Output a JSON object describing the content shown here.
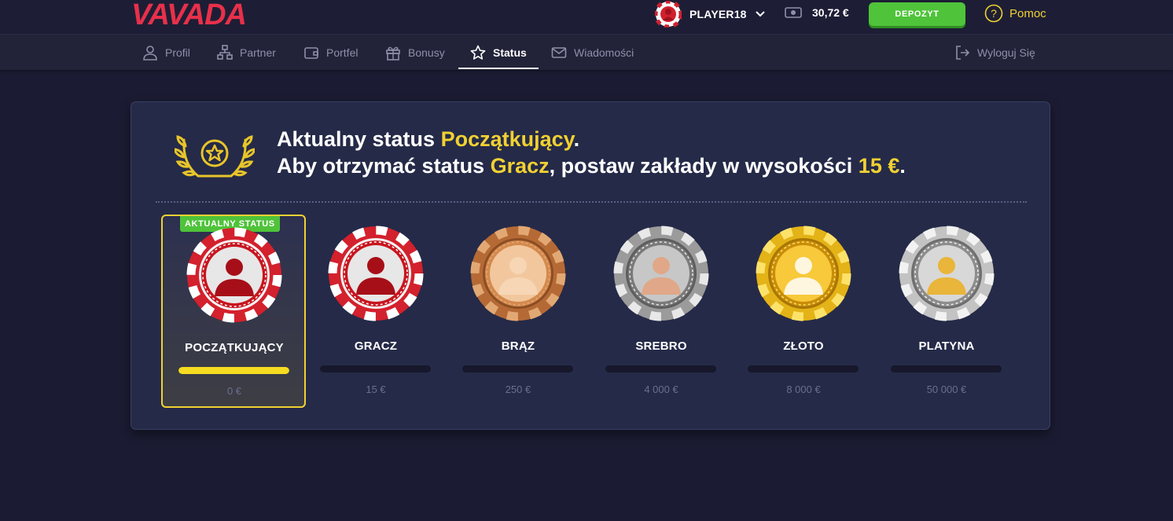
{
  "header": {
    "logo_text": "VAVADA",
    "username": "PLAYER18",
    "balance": "30,72 €",
    "deposit_label": "DEPOZYT",
    "help_label": "Pomoc"
  },
  "nav": {
    "items": [
      {
        "label": "Profil",
        "icon": "user-icon"
      },
      {
        "label": "Partner",
        "icon": "network-icon"
      },
      {
        "label": "Portfel",
        "icon": "wallet-icon"
      },
      {
        "label": "Bonusy",
        "icon": "gift-icon"
      },
      {
        "label": "Status",
        "icon": "star-icon",
        "active": true
      },
      {
        "label": "Wiadomości",
        "icon": "mail-icon"
      }
    ],
    "logout_label": "Wyloguj Się"
  },
  "status": {
    "line1_prefix": "Aktualny status ",
    "current_status": "Początkujący",
    "line1_suffix": ".",
    "line2_prefix": "Aby otrzymać status ",
    "next_status": "Gracz",
    "line2_middle": ", postaw zakłady w wysokości ",
    "amount_needed": "15 €",
    "line2_suffix": ".",
    "current_badge": "AKTUALNY STATUS",
    "levels": [
      {
        "name": "POCZĄTKUJĄCY",
        "threshold": "0 €",
        "progress": 1.0,
        "chip": "red",
        "current": true
      },
      {
        "name": "GRACZ",
        "threshold": "15 €",
        "progress": 0,
        "chip": "red"
      },
      {
        "name": "BRĄZ",
        "threshold": "250 €",
        "progress": 0,
        "chip": "bronze"
      },
      {
        "name": "SREBRO",
        "threshold": "4 000 €",
        "progress": 0,
        "chip": "silver"
      },
      {
        "name": "ZŁOTO",
        "threshold": "8 000 €",
        "progress": 0,
        "chip": "gold"
      },
      {
        "name": "PLATYNA",
        "threshold": "50 000 €",
        "progress": 0,
        "chip": "platinum"
      }
    ]
  },
  "colors": {
    "accent_yellow": "#f0d132",
    "deposit_green": "#4fc33a",
    "logo_red": "#e8304a",
    "bar_fill": "#f5dc21"
  }
}
